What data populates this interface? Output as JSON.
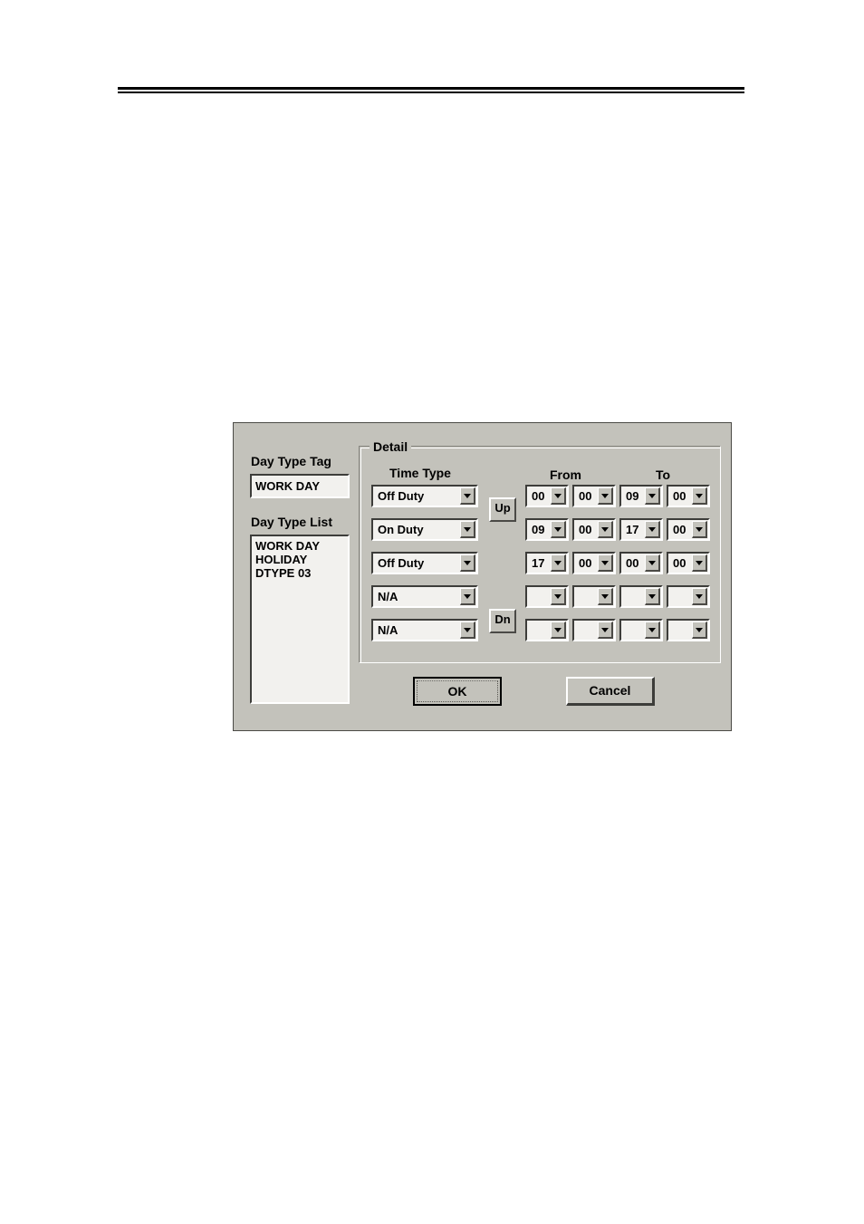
{
  "page": {
    "rule": "double-horizontal-rule"
  },
  "dialog": {
    "day_type_tag": {
      "label": "Day Type Tag",
      "value": "WORK DAY"
    },
    "day_type_list": {
      "label": "Day Type List",
      "items": [
        "WORK DAY",
        "HOLIDAY",
        "DTYPE 03"
      ],
      "selected": "WORK DAY"
    },
    "detail": {
      "group_title": "Detail",
      "headers": {
        "time_type": "Time Type",
        "from": "From",
        "to": "To"
      },
      "rows": [
        {
          "time_type": "Off Duty",
          "from_hour": "00",
          "from_min": "00",
          "to_hour": "09",
          "to_min": "00"
        },
        {
          "time_type": "On Duty",
          "from_hour": "09",
          "from_min": "00",
          "to_hour": "17",
          "to_min": "00"
        },
        {
          "time_type": "Off Duty",
          "from_hour": "17",
          "from_min": "00",
          "to_hour": "00",
          "to_min": "00"
        },
        {
          "time_type": "N/A",
          "from_hour": "",
          "from_min": "",
          "to_hour": "",
          "to_min": ""
        },
        {
          "time_type": "N/A",
          "from_hour": "",
          "from_min": "",
          "to_hour": "",
          "to_min": ""
        }
      ],
      "move_up_label": "Up",
      "move_down_label": "Dn"
    },
    "buttons": {
      "ok": "OK",
      "cancel": "Cancel"
    },
    "colors": {
      "dialog_face": "#c3c2bb",
      "field_bg": "#f2f1ee",
      "border_dark": "#3d3d3a",
      "border_light": "#ffffff",
      "text": "#000000"
    }
  }
}
